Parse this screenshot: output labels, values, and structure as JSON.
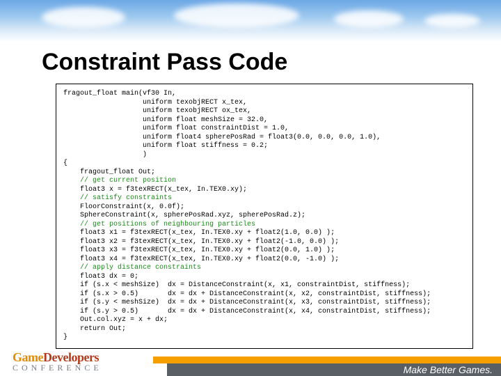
{
  "title": "Constraint Pass Code",
  "code": {
    "l01": "fragout_float main(vf30 In,",
    "l02": "                   uniform texobjRECT x_tex,",
    "l03": "                   uniform texobjRECT ox_tex,",
    "l04": "                   uniform float meshSize = 32.0,",
    "l05": "                   uniform float constraintDist = 1.0,",
    "l06": "                   uniform float4 spherePosRad = float3(0.0, 0.0, 0.0, 1.0),",
    "l07": "                   uniform float stiffness = 0.2;",
    "l08": "                   )",
    "l09": "{",
    "l10": "    fragout_float Out;",
    "l11": "    // get current position",
    "l12": "    float3 x = f3texRECT(x_tex, In.TEX0.xy);",
    "l13": "    // satisfy constraints",
    "l14": "    FloorConstraint(x, 0.0f);",
    "l15": "    SphereConstraint(x, spherePosRad.xyz, spherePosRad.z);",
    "l16": "    // get positions of neighbouring particles",
    "l17": "    float3 x1 = f3texRECT(x_tex, In.TEX0.xy + float2(1.0, 0.0) );",
    "l18": "    float3 x2 = f3texRECT(x_tex, In.TEX0.xy + float2(-1.0, 0.0) );",
    "l19": "    float3 x3 = f3texRECT(x_tex, In.TEX0.xy + float2(0.0, 1.0) );",
    "l20": "    float3 x4 = f3texRECT(x_tex, In.TEX0.xy + float2(0.0, -1.0) );",
    "l21": "    // apply distance constraints",
    "l22": "    float3 dx = 0;",
    "l23": "    if (s.x < meshSize)  dx = DistanceConstraint(x, x1, constraintDist, stiffness);",
    "l24": "    if (s.x > 0.5)       dx = dx + DistanceConstraint(x, x2, constraintDist, stiffness);",
    "l25": "    if (s.y < meshSize)  dx = dx + DistanceConstraint(x, x3, constraintDist, stiffness);",
    "l26": "    if (s.y > 0.5)       dx = dx + DistanceConstraint(x, x4, constraintDist, stiffness);",
    "l27": "    Out.col.xyz = x + dx;",
    "l28": "    return Out;",
    "l29": "}"
  },
  "footer": {
    "tagline": "Make Better Games.",
    "logo_game": "Game",
    "logo_dev": "Developers",
    "logo_conf": "CONFERENCE"
  }
}
